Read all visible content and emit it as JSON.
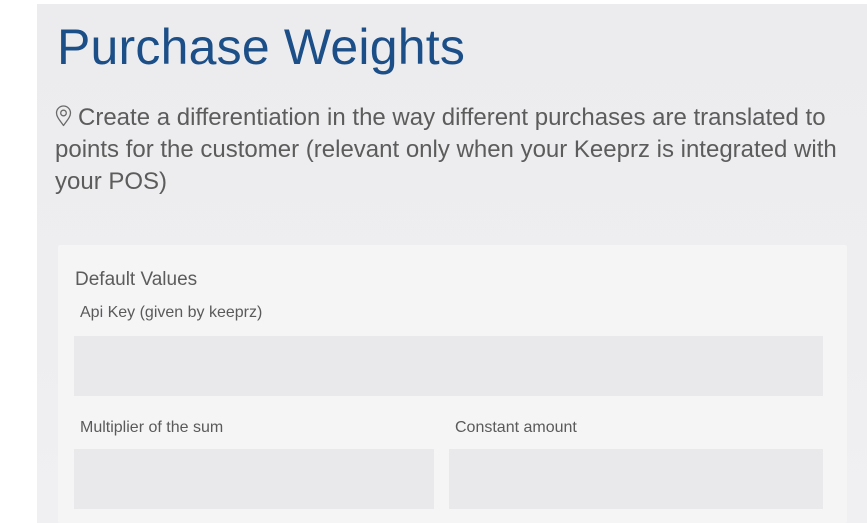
{
  "header": {
    "title": "Purchase Weights",
    "description": "Create a differentiation in the way different purchases are translated to points for the customer (relevant only when your Keeprz is integrated with your POS)",
    "description_icon": "location-pin-icon"
  },
  "form": {
    "section_title": "Default Values",
    "api_key": {
      "label": "Api Key (given by keeprz)",
      "value": ""
    },
    "multiplier": {
      "label": "Multiplier of the sum",
      "value": ""
    },
    "constant": {
      "label": "Constant amount",
      "value": ""
    }
  },
  "colors": {
    "title": "#1c4f88",
    "text": "#5c5c5c",
    "input_bg": "#e9e9eb"
  }
}
